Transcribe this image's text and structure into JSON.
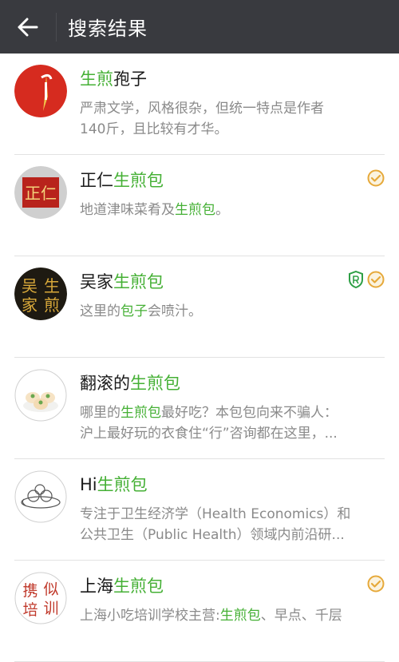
{
  "header": {
    "title": "搜索结果"
  },
  "results": [
    {
      "name": [
        {
          "t": "生煎",
          "h": true
        },
        {
          "t": "孢子",
          "h": false
        }
      ],
      "desc": [
        [
          {
            "t": "严肃文学，风格很杂，但统一特点是作者",
            "h": false
          }
        ],
        [
          {
            "t": "140斤，且比较有才华。",
            "h": false
          }
        ]
      ],
      "verified": false,
      "shield": false,
      "avatar_icon": "red-circle-logo"
    },
    {
      "name": [
        {
          "t": "正仁",
          "h": false
        },
        {
          "t": "生煎包",
          "h": true
        }
      ],
      "desc": [
        [
          {
            "t": "地道津味菜肴及",
            "h": false
          },
          {
            "t": "生煎包",
            "h": true
          },
          {
            "t": "。",
            "h": false
          }
        ]
      ],
      "verified": true,
      "shield": false,
      "avatar_icon": "red-seal-zhengren",
      "avatar_text": "正仁"
    },
    {
      "name": [
        {
          "t": "吴家",
          "h": false
        },
        {
          "t": "生煎包",
          "h": true
        }
      ],
      "desc": [
        [
          {
            "t": "这里的",
            "h": false
          },
          {
            "t": "包子",
            "h": true
          },
          {
            "t": "会喷汁。",
            "h": false
          }
        ]
      ],
      "verified": true,
      "shield": true,
      "avatar_icon": "black-gold-calligraphy",
      "avatar_text": [
        "吴",
        "生",
        "家",
        "煎"
      ]
    },
    {
      "name": [
        {
          "t": "翻滚的",
          "h": false
        },
        {
          "t": "生煎包",
          "h": true
        }
      ],
      "desc": [
        [
          {
            "t": "哪里的",
            "h": false
          },
          {
            "t": "生煎包",
            "h": true
          },
          {
            "t": "最好吃？本包包向来不骗人：",
            "h": false
          }
        ],
        [
          {
            "t": "沪上最好玩的衣食住“行”咨询都在这里，...",
            "h": false
          }
        ]
      ],
      "verified": false,
      "shield": false,
      "avatar_icon": "buns-illustration"
    },
    {
      "name": [
        {
          "t": "Hi",
          "h": false
        },
        {
          "t": "生煎包",
          "h": true
        }
      ],
      "desc": [
        [
          {
            "t": "专注于卫生经济学（Health Economics）和",
            "h": false
          }
        ],
        [
          {
            "t": "公共卫生（Public Health）领域内前沿研...",
            "h": false
          }
        ]
      ],
      "verified": false,
      "shield": false,
      "avatar_icon": "buns-sketch"
    },
    {
      "name": [
        {
          "t": "上海",
          "h": false
        },
        {
          "t": "生煎包",
          "h": true
        }
      ],
      "desc": [
        [
          {
            "t": "上海小吃培训学校主营:",
            "h": false
          },
          {
            "t": "生煎包",
            "h": true
          },
          {
            "t": "、早点、千层",
            "h": false
          }
        ]
      ],
      "verified": true,
      "shield": false,
      "avatar_icon": "red-calligraphy-seal",
      "avatar_text": [
        "携",
        "似",
        "培",
        "训"
      ]
    }
  ],
  "colors": {
    "topbar": "#393a3f",
    "highlight": "#45b035",
    "verified": "#e6a93a",
    "shield": "#2e9f45"
  }
}
